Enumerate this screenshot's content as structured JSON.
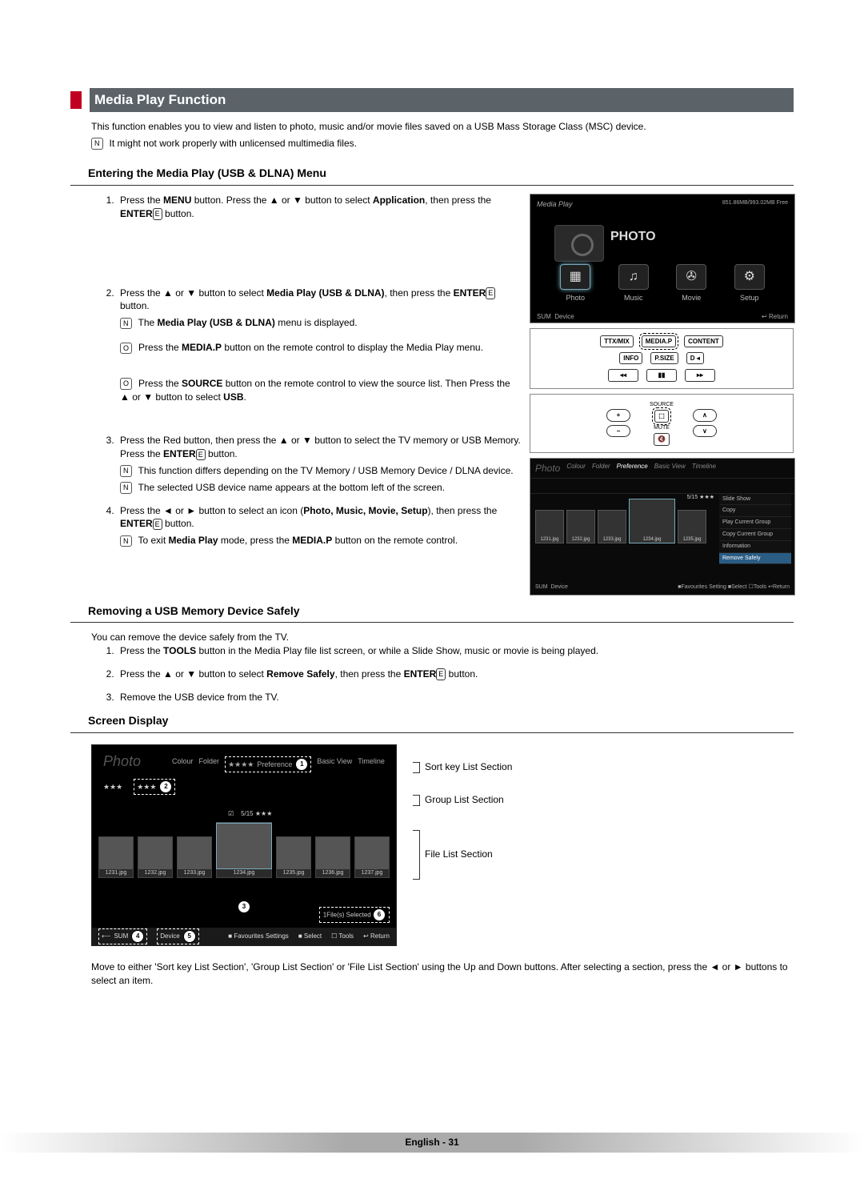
{
  "title": "Media Play Function",
  "intro": "This function enables you to view and listen to photo, music and/or movie files saved on a USB Mass Storage Class (MSC) device.",
  "intro_note": "It might not work properly with unlicensed multimedia files.",
  "h_entering": "Entering the Media Play (USB & DLNA) Menu",
  "steps": {
    "s1a": "Press the ",
    "s1b": "MENU",
    "s1c": " button. Press the ▲ or ▼ button to select ",
    "s1d": "Application",
    "s1e": ", then press the ",
    "s1f": "ENTER",
    "s1g": " button.",
    "s2a": "Press the ▲ or ▼ button to select ",
    "s2b": "Media Play (USB & DLNA)",
    "s2c": ", then press the ",
    "s2d": "ENTER",
    "s2e": " button.",
    "s2note1a": "The ",
    "s2note1b": "Media Play (USB & DLNA)",
    "s2note1c": " menu is displayed.",
    "s2note2a": "Press the ",
    "s2note2b": "MEDIA.P",
    "s2note2c": " button on the remote control to display the Media Play menu.",
    "s2note3a": "Press the ",
    "s2note3b": "SOURCE",
    "s2note3c": " button on the remote control to view the source list. Then Press the ▲ or ▼ button to select ",
    "s2note3d": "USB",
    "s2note3e": ".",
    "s3a": "Press the Red button, then press the ▲ or ▼ button to select the TV memory or USB Memory. Press the ",
    "s3b": "ENTER",
    "s3c": " button.",
    "s3note1": "This function differs depending on the TV Memory / USB Memory Device / DLNA device.",
    "s3note2": "The selected USB device name appears at the bottom left of the screen.",
    "s4a": "Press the ◄ or ► button to select an icon (",
    "s4b": "Photo, Music, Movie, Setup",
    "s4c": "), then press the ",
    "s4d": "ENTER",
    "s4e": " button.",
    "s4note1a": "To exit ",
    "s4note1b": "Media Play",
    "s4note1c": " mode, press the ",
    "s4note1d": "MEDIA.P",
    "s4note1e": " button on the remote control."
  },
  "h_removing": "Removing a USB Memory Device Safely",
  "removing_intro": "You can remove the device safely from the TV.",
  "r1a": "Press the ",
  "r1b": "TOOLS",
  "r1c": " button in the Media Play file list screen, or while a Slide Show, music or movie is being played.",
  "r2a": "Press the ▲ or ▼ button to select ",
  "r2b": "Remove Safely",
  "r2c": ", then press the ",
  "r2d": "ENTER",
  "r2e": " button.",
  "r3": "Remove the USB device from the TV.",
  "h_screen": "Screen Display",
  "after_diagram": "Move to either 'Sort key List Section', 'Group List Section' or 'File List Section' using the Up and Down buttons. After selecting a section, press the ◄ or ► buttons to select an item.",
  "footer": "English - 31",
  "tv": {
    "title": "Media Play",
    "usb": "851.86MB/993.02MB Free",
    "sum": "SUM",
    "photo_big": "PHOTO",
    "icons": {
      "photo": "Photo",
      "music": "Music",
      "movie": "Movie",
      "setup": "Setup"
    },
    "device": "Device",
    "ret": "Return"
  },
  "remote1": {
    "r1": [
      "TTX/MIX",
      "MEDIA.P",
      "CONTENT"
    ],
    "r2": [
      "INFO",
      "P.SIZE",
      "D ◂"
    ],
    "r3": [
      "◂◂",
      "▮▮",
      "▸▸"
    ]
  },
  "remote2": {
    "labels": [
      "SOURCE",
      "MUTE"
    ]
  },
  "photofig": {
    "top": [
      "Photo",
      "Colour",
      "Folder",
      "Preference",
      "Basic View",
      "Timeline"
    ],
    "count": "5/15",
    "files": [
      "1231.jpg",
      "1232.jpg",
      "1233.jpg",
      "1234.jpg",
      "1235.jpg",
      "1236.jpg",
      "1237.jpg"
    ],
    "menu": [
      "Slide Show",
      "Copy",
      "Play Current Group",
      "Copy Current Group",
      "Information",
      "Remove Safely"
    ],
    "btm": [
      "SUM",
      "Device",
      "Favourites Setting",
      "Select",
      "Tools",
      "Return"
    ]
  },
  "diagram": {
    "photo": "Photo",
    "sort": [
      "Colour",
      "Folder",
      "Preference",
      "Basic View",
      "Timeline"
    ],
    "count": "5/15",
    "files": [
      "1231.jpg",
      "1232.jpg",
      "1233.jpg",
      "1234.jpg",
      "1235.jpg",
      "1236.jpg",
      "1237.jpg"
    ],
    "selected": "1File(s) Selected",
    "btm_sum": "SUM",
    "btm_device": "Device",
    "btm_items": [
      "Favourites Settings",
      "Select",
      "Tools",
      "Return"
    ],
    "badges": [
      "1",
      "2",
      "3",
      "4",
      "5",
      "6"
    ]
  },
  "legend": {
    "l1": "Sort key List Section",
    "l2": "Group List Section",
    "l3": "File List Section"
  },
  "glyph_note": "N",
  "glyph_remote": "O",
  "glyph_enter": "E"
}
